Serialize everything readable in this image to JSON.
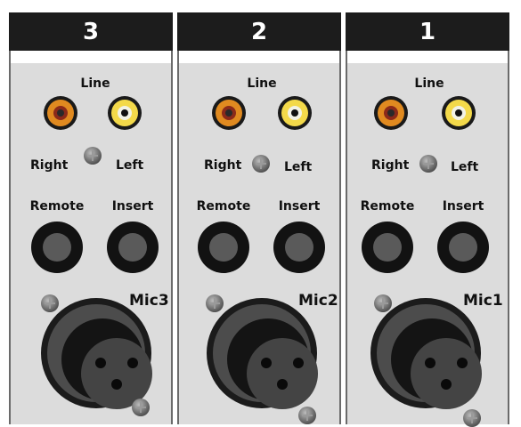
{
  "channels": [
    {
      "number": "3",
      "line_label": "Line",
      "right_label": "Right",
      "left_label": "Left",
      "remote_label": "Remote",
      "insert_label": "Insert",
      "mic_label": "Mic3"
    },
    {
      "number": "2",
      "line_label": "Line",
      "right_label": "Right",
      "left_label": "Left",
      "remote_label": "Remote",
      "insert_label": "Insert",
      "mic_label": "Mic2"
    },
    {
      "number": "1",
      "line_label": "Line",
      "right_label": "Right",
      "left_label": "Left",
      "remote_label": "Remote",
      "insert_label": "Insert",
      "mic_label": "Mic1"
    }
  ],
  "colors": {
    "panel": "#dcdcdc",
    "header": "#1c1c1c",
    "rca_right_ring": "#e08a20",
    "rca_left_ring": "#f3d94a"
  }
}
